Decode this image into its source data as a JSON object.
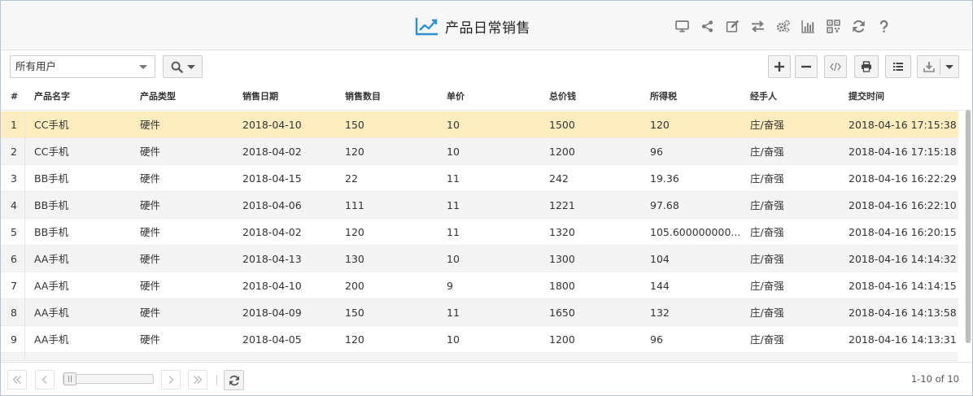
{
  "header": {
    "title": "产品日常销售",
    "title_icon": "line-chart-icon",
    "icons": [
      "monitor-icon",
      "share-icon",
      "edit-icon",
      "exchange-icon",
      "gears-icon",
      "bar-chart-icon",
      "qrcode-icon",
      "refresh-icon",
      "help-icon"
    ]
  },
  "toolbar": {
    "user_filter": "所有用户",
    "search_icon": "search-icon",
    "buttons": [
      "add-icon",
      "remove-icon",
      "code-icon",
      "print-icon",
      "list-icon",
      "download-icon"
    ]
  },
  "table": {
    "columns": [
      "#",
      "产品名字",
      "产品类型",
      "销售日期",
      "销售数目",
      "单价",
      "总价钱",
      "所得税",
      "经手人",
      "提交时间"
    ],
    "rows": [
      [
        "1",
        "CC手机",
        "硬件",
        "2018-04-10",
        "150",
        "10",
        "1500",
        "120",
        "庄/奋强",
        "2018-04-16 17:15:38"
      ],
      [
        "2",
        "CC手机",
        "硬件",
        "2018-04-02",
        "120",
        "10",
        "1200",
        "96",
        "庄/奋强",
        "2018-04-16 17:15:18"
      ],
      [
        "3",
        "BB手机",
        "硬件",
        "2018-04-15",
        "22",
        "11",
        "242",
        "19.36",
        "庄/奋强",
        "2018-04-16 16:22:29"
      ],
      [
        "4",
        "BB手机",
        "硬件",
        "2018-04-06",
        "111",
        "11",
        "1221",
        "97.68",
        "庄/奋强",
        "2018-04-16 16:22:10"
      ],
      [
        "5",
        "BB手机",
        "硬件",
        "2018-04-02",
        "120",
        "11",
        "1320",
        "105.600000000...",
        "庄/奋强",
        "2018-04-16 16:20:15"
      ],
      [
        "6",
        "AA手机",
        "硬件",
        "2018-04-13",
        "130",
        "10",
        "1300",
        "104",
        "庄/奋强",
        "2018-04-16 14:14:32"
      ],
      [
        "7",
        "AA手机",
        "硬件",
        "2018-04-10",
        "200",
        "9",
        "1800",
        "144",
        "庄/奋强",
        "2018-04-16 14:14:15"
      ],
      [
        "8",
        "AA手机",
        "硬件",
        "2018-04-09",
        "150",
        "11",
        "1650",
        "132",
        "庄/奋强",
        "2018-04-16 14:13:58"
      ],
      [
        "9",
        "AA手机",
        "硬件",
        "2018-04-05",
        "120",
        "10",
        "1200",
        "96",
        "庄/奋强",
        "2018-04-16 14:13:31"
      ]
    ],
    "selected_row": 0
  },
  "pager": {
    "info": "1-10 of 10",
    "icons": [
      "first-page-icon",
      "prev-page-icon",
      "next-page-icon",
      "last-page-icon",
      "refresh-icon"
    ]
  },
  "colors": {
    "accent": "#2b8fd0",
    "selected_row": "#fdedbf",
    "icon_gray": "#7a7a7a"
  }
}
